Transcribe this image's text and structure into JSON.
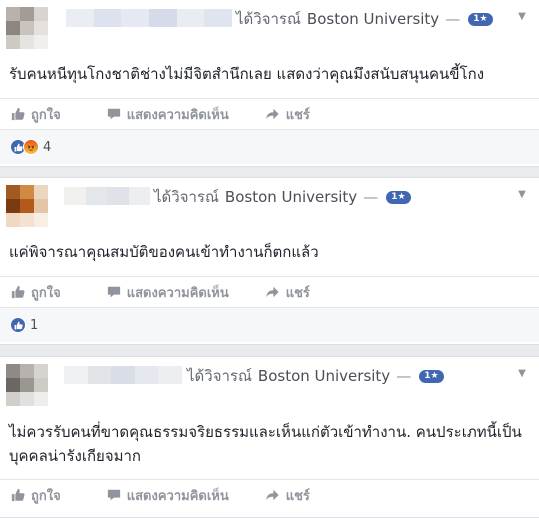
{
  "colors": {
    "accent": "#4267b2",
    "text": "#1d2129",
    "muted": "#90949c",
    "page_bg": "#e9ebee"
  },
  "actions": {
    "like": "ถูกใจ",
    "comment": "แสดงความคิดเห็น",
    "share": "แชร์"
  },
  "posts": [
    {
      "verb": "ได้วิจารณ์",
      "page": "Boston University",
      "dash": "—",
      "rating": "1★",
      "text_lines": [
        "รับคนหนีทุนโกงชาติช่างไม่มีจิตสำนึกเลย แสดงว่าคุณมึงสนับสนุนคนขี้โกง"
      ],
      "reactions": [
        "like-icon",
        "angry-icon"
      ],
      "reaction_count": "4"
    },
    {
      "verb": "ได้วิจารณ์",
      "page": "Boston University",
      "dash": "—",
      "rating": "1★",
      "text_lines": [
        "แค่พิจารณาคุณสมบัติของคนเข้าทำงานก็ตกแล้ว"
      ],
      "reactions": [
        "like-icon"
      ],
      "reaction_count": "1"
    },
    {
      "verb": "ได้วิจารณ์",
      "page": "Boston University",
      "dash": "—",
      "rating": "1★",
      "text_lines": [
        "ไม่ควรรับคนที่ขาดคุณธรรมจริยธรรมและเห็นแก่ตัวเข้าทำงาน. คนประเภทนี้เป็น",
        "บุคคลน่ารังเกียจมาก"
      ]
    }
  ]
}
